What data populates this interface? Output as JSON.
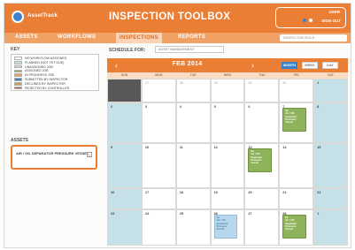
{
  "header": {
    "logo_text": "AssetTrack",
    "title": "INSPECTION TOOLBOX",
    "user_name": "USER",
    "user_link": "SIGN OUT"
  },
  "nav": {
    "items": [
      "ASSETS",
      "WORKFLOWS",
      "INSPECTIONS",
      "REPORTS"
    ],
    "active": "INSPECTIONS",
    "role_select": "INSPECTOR ROLE"
  },
  "sidebar": {
    "key_heading": "KEY",
    "key_items": [
      {
        "label": "NO WORKFLOW ASSIGNED",
        "color": "#ffffff"
      },
      {
        "label": "PLANNED (NOT YET DUE)",
        "color": "#c5e0e7"
      },
      {
        "label": "UNASSIGNED JOB",
        "color": "#d8d8d8"
      },
      {
        "label": "ASSIGNED JOB",
        "color": "#8fb35a"
      },
      {
        "label": "IN PROGRESS JOB",
        "color": "#f2a165"
      },
      {
        "label": "SUBMITTED BY INSPECTOR",
        "color": "#3c82c8"
      },
      {
        "label": "DECLINED BY INSPECTOR",
        "color": "#c8a060"
      },
      {
        "label": "REJECTED BY CONTROLLER",
        "color": "#d9534f"
      }
    ],
    "assets_heading": "ASSETS",
    "selected_asset": "AIR / OIL SEPARATOR PRESSURE VESSEL",
    "remove_label": "×"
  },
  "schedule": {
    "label": "SCHEDULE FOR:",
    "select_value": "ASSET MANAGEMENT"
  },
  "calendar": {
    "month_title": "FEB 2014",
    "prev_label": "‹",
    "next_label": "›",
    "views": [
      "MONTH",
      "WEEK",
      "DAY"
    ],
    "active_view": "MONTH",
    "day_names": [
      "SUN",
      "MON",
      "TUE",
      "WED",
      "THU",
      "FRI",
      "SAT"
    ],
    "weeks": [
      [
        {
          "n": "",
          "t": "dark"
        },
        {
          "n": "27",
          "t": "other"
        },
        {
          "n": "28",
          "t": "other"
        },
        {
          "n": "29",
          "t": "other"
        },
        {
          "n": "30",
          "t": "other"
        },
        {
          "n": "31",
          "t": "other"
        },
        {
          "n": "1",
          "t": "weekend"
        }
      ],
      [
        {
          "n": "2",
          "t": "weekend"
        },
        {
          "n": "3",
          "t": ""
        },
        {
          "n": "4",
          "t": ""
        },
        {
          "n": "5",
          "t": ""
        },
        {
          "n": "6",
          "t": ""
        },
        {
          "n": "7",
          "t": ""
        },
        {
          "n": "8",
          "t": "weekend"
        }
      ],
      [
        {
          "n": "9",
          "t": "weekend"
        },
        {
          "n": "10",
          "t": ""
        },
        {
          "n": "11",
          "t": ""
        },
        {
          "n": "12",
          "t": ""
        },
        {
          "n": "13",
          "t": ""
        },
        {
          "n": "14",
          "t": ""
        },
        {
          "n": "15",
          "t": "weekend"
        }
      ],
      [
        {
          "n": "16",
          "t": "weekend"
        },
        {
          "n": "17",
          "t": ""
        },
        {
          "n": "18",
          "t": ""
        },
        {
          "n": "19",
          "t": ""
        },
        {
          "n": "20",
          "t": ""
        },
        {
          "n": "21",
          "t": ""
        },
        {
          "n": "22",
          "t": "weekend"
        }
      ],
      [
        {
          "n": "23",
          "t": "weekend"
        },
        {
          "n": "24",
          "t": ""
        },
        {
          "n": "25",
          "t": ""
        },
        {
          "n": "26",
          "t": ""
        },
        {
          "n": "27",
          "t": ""
        },
        {
          "n": "28",
          "t": ""
        },
        {
          "n": "1",
          "t": "weekend"
        }
      ]
    ],
    "events": [
      {
        "week": 1,
        "day": 5,
        "color": "green",
        "lines": [
          "9a",
          "Air / Oil",
          "Separator",
          "Pressure",
          "Vessel"
        ]
      },
      {
        "week": 2,
        "day": 4,
        "color": "green",
        "lines": [
          "9a",
          "Air / Oil",
          "Separator",
          "Pressure",
          "Vessel"
        ]
      },
      {
        "week": 4,
        "day": 3,
        "color": "blue",
        "lines": [
          "9a",
          "Air / Oil",
          "Separator",
          "Pressure",
          "Vessel"
        ]
      },
      {
        "week": 4,
        "day": 5,
        "color": "green",
        "lines": [
          "9a",
          "Air / Oil",
          "Separator",
          "Pressure",
          "Vessel"
        ]
      }
    ]
  }
}
